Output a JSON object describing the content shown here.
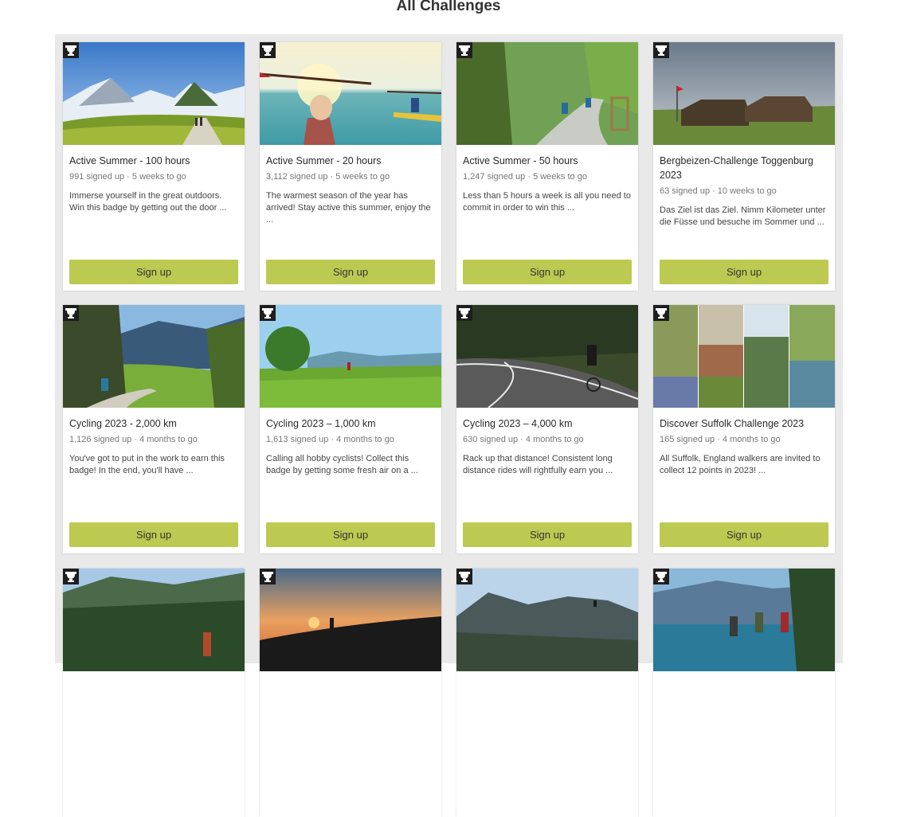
{
  "page": {
    "title": "All Challenges"
  },
  "cards": [
    {
      "title": "Active Summer - 100 hours",
      "meta": "991 signed up · 5 weeks to go",
      "desc": "Immerse yourself in the great outdoors. Win this badge by getting out the door ...",
      "button": "Sign up"
    },
    {
      "title": "Active Summer - 20 hours",
      "meta": "3,112 signed up · 5 weeks to go",
      "desc": "The warmest season of the year has arrived! Stay active this summer, enjoy the ...",
      "button": "Sign up"
    },
    {
      "title": "Active Summer - 50 hours",
      "meta": "1,247 signed up · 5 weeks to go",
      "desc": "Less than 5 hours a week is all you need to commit in order to win this ...",
      "button": "Sign up"
    },
    {
      "title": "Bergbeizen-Challenge Toggenburg 2023",
      "meta": "63 signed up · 10 weeks to go",
      "desc": "Das Ziel ist das Ziel. Nimm Kilometer unter die Füsse und besuche im Sommer und ...",
      "button": "Sign up"
    },
    {
      "title": "Cycling 2023 - 2,000 km",
      "meta": "1,126 signed up · 4 months to go",
      "desc": "You've got to put in the work to earn this badge! In the end, you'll have ...",
      "button": "Sign up"
    },
    {
      "title": "Cycling 2023 – 1,000 km",
      "meta": "1,613 signed up · 4 months to go",
      "desc": "Calling all hobby cyclists! Collect this badge by getting some fresh air on a ...",
      "button": "Sign up"
    },
    {
      "title": "Cycling 2023 – 4,000 km",
      "meta": "630 signed up · 4 months to go",
      "desc": "Rack up that distance! Consistent long distance rides will rightfully earn you ...",
      "button": "Sign up"
    },
    {
      "title": "Discover Suffolk Challenge 2023",
      "meta": "165 signed up · 4 months to go",
      "desc": "All Suffolk, England walkers are invited to collect 12 points in 2023! ...",
      "button": "Sign up"
    },
    {
      "title": "",
      "meta": "",
      "desc": "",
      "button": ""
    },
    {
      "title": "",
      "meta": "",
      "desc": "",
      "button": ""
    },
    {
      "title": "",
      "meta": "",
      "desc": "",
      "button": ""
    },
    {
      "title": "",
      "meta": "",
      "desc": "",
      "button": ""
    }
  ],
  "icons": {
    "badge": "trophy-icon"
  },
  "colors": {
    "button": "#bcca52",
    "panel": "#e9e9e9"
  }
}
